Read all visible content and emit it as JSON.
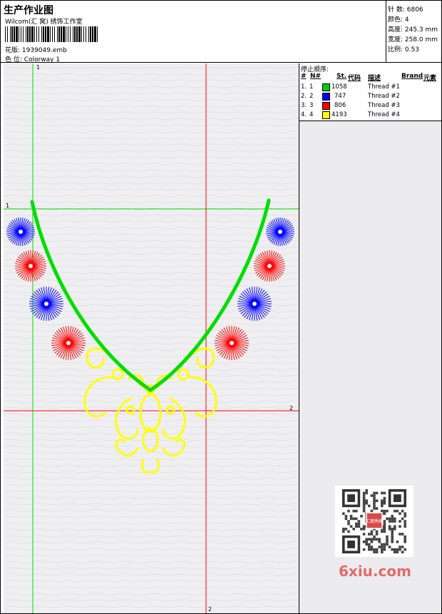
{
  "header": {
    "title": "生产作业图",
    "company": "Wilcom(汇 窝) 绣饰工作室",
    "design_label": "花版:",
    "design_value": "1939049.emb",
    "colorway_label": "色 位:",
    "colorway_value": "Colorway 1"
  },
  "stats": {
    "stitches": "针 数: 6806",
    "colors": "颜色: 4",
    "height": "高度: 245.3 mm",
    "width": "宽度: 258.0 mm",
    "scale": "比例: 0.53"
  },
  "stop_sequence": {
    "title": "停止顺序:",
    "columns": [
      "#",
      "N#",
      "St.",
      "代码",
      "描述",
      "Brand",
      "元素"
    ],
    "rows": [
      {
        "idx": "1.",
        "n": "1",
        "code": "1058",
        "desc": "Thread #1",
        "color": "#00cc00"
      },
      {
        "idx": "2.",
        "n": "2",
        "code": "747",
        "desc": "Thread #2",
        "color": "#0000ff"
      },
      {
        "idx": "3.",
        "n": "3",
        "code": "806",
        "desc": "Thread #3",
        "color": "#ff0000"
      },
      {
        "idx": "4.",
        "n": "4",
        "code": "4193",
        "desc": "Thread #4",
        "color": "#ffff00"
      }
    ]
  },
  "guides": {
    "vertical_green": "1",
    "horizontal_green": "1",
    "horizontal_red": "2",
    "vertical_red": "2"
  },
  "watermark": "6xiu.com",
  "qr_badge": "汇窝秀图",
  "palette": {
    "green": "#00dd00",
    "blue": "#0000ff",
    "red": "#ff0000",
    "yellow": "#ffff00"
  }
}
